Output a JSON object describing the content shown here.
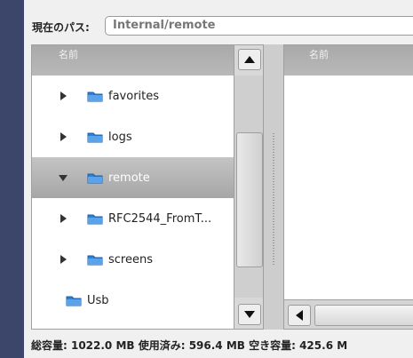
{
  "path": {
    "label": "現在のパス:",
    "value": "Internal/remote"
  },
  "left_pane": {
    "column_header": "名前",
    "items": [
      {
        "label": "favorites",
        "expander": "collapsed",
        "selected": false
      },
      {
        "label": "logs",
        "expander": "collapsed",
        "selected": false
      },
      {
        "label": "remote",
        "expander": "expanded",
        "selected": true
      },
      {
        "label": "RFC2544_FromT...",
        "expander": "collapsed",
        "selected": false
      },
      {
        "label": "screens",
        "expander": "collapsed",
        "selected": false
      },
      {
        "label": "Usb",
        "expander": "none",
        "selected": false
      }
    ]
  },
  "right_pane": {
    "column_header": "名前"
  },
  "status": "総容量: 1022.0 MB   使用済み: 596.4 MB   空き容量: 425.6 M",
  "colors": {
    "folder": "#2f7fd4",
    "selected_bg": "#b4b4b4",
    "sidebar": "#3b466a"
  }
}
